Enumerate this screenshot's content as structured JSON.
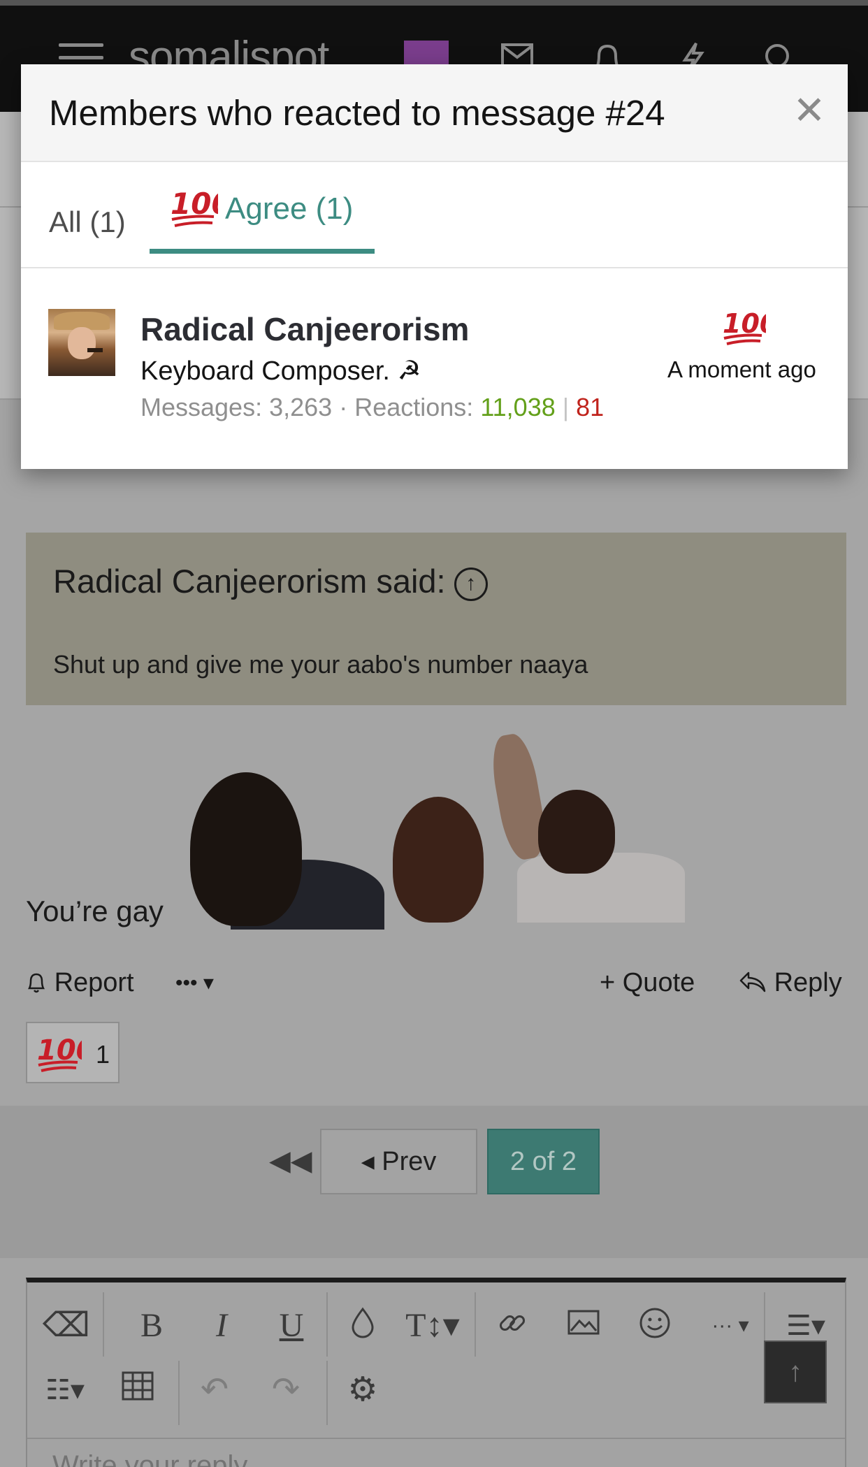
{
  "topbar": {
    "logo": "somalispot",
    "icons": [
      "menu-icon",
      "search-box",
      "mail-icon",
      "bell-icon",
      "bolt-icon",
      "search-icon"
    ]
  },
  "modal": {
    "title": "Members who reacted to message #24",
    "tabs": [
      {
        "label": "All (1)"
      },
      {
        "label": "Agree (1)",
        "emoji": "💯"
      }
    ],
    "members": [
      {
        "name": "Radical Canjeerorism",
        "user_title": "Keyboard Composer. ☭",
        "messages_label": "Messages:",
        "messages": "3,263",
        "reactions_label": "Reactions:",
        "reactions_pos": "11,038",
        "reactions_neg": "81",
        "reaction_emoji": "💯",
        "time": "A moment ago"
      }
    ]
  },
  "post": {
    "quote_author": "Radical Canjeerorism said:",
    "quote_text": "Shut up and give me your aabo's number naaya",
    "body_text": "You’re gay",
    "actions": {
      "report": "Report",
      "more": "•••",
      "quote": "+ Quote",
      "reply": "Reply"
    },
    "reaction_count": "1"
  },
  "pagination": {
    "prev": "Prev",
    "current": "2 of 2"
  },
  "editor": {
    "placeholder": "Write your reply..."
  },
  "colors": {
    "accent": "#47a7a0",
    "positive": "#63a01a",
    "negative": "#c0231c",
    "emoji_red": "#d81e2c"
  }
}
